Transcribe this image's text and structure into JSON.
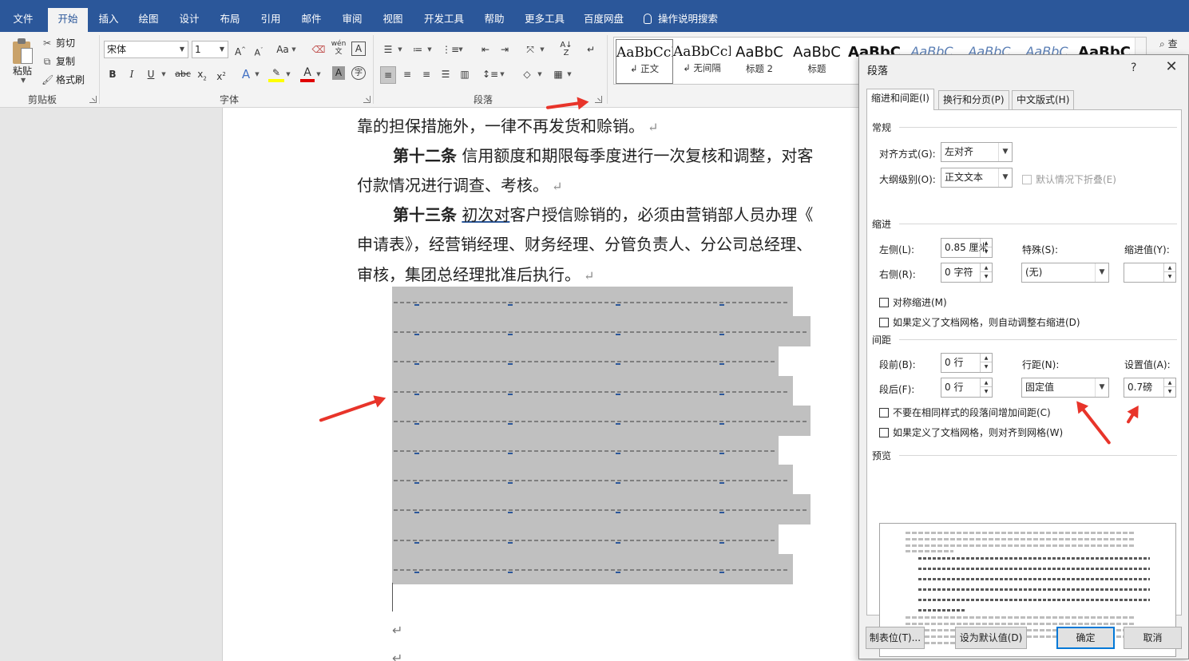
{
  "ribbon": {
    "tabs": [
      "文件",
      "开始",
      "插入",
      "绘图",
      "设计",
      "布局",
      "引用",
      "邮件",
      "审阅",
      "视图",
      "开发工具",
      "帮助",
      "更多工具",
      "百度网盘"
    ],
    "active_tab": "开始",
    "tell_me": "操作说明搜索",
    "clipboard": {
      "paste": "粘贴",
      "cut": "剪切",
      "copy": "复制",
      "format_painter": "格式刷",
      "group_label": "剪贴板"
    },
    "font": {
      "name": "宋体",
      "size": "1",
      "group_label": "字体",
      "change_case": "Aa"
    },
    "paragraph": {
      "group_label": "段落"
    },
    "styles": [
      {
        "sample": "AaBbCcI",
        "name": "↲ 正文"
      },
      {
        "sample": "AaBbCcI",
        "name": "↲ 无间隔"
      },
      {
        "sample": "AaBbC",
        "name": "标题 2"
      },
      {
        "sample": "AaBbC",
        "name": "标题"
      },
      {
        "sample": "AaBbC",
        "name": ""
      },
      {
        "sample": "AaBbC",
        "name": ""
      },
      {
        "sample": "AaBbC",
        "name": ""
      },
      {
        "sample": "AaBbC",
        "name": ""
      },
      {
        "sample": "AaBbC",
        "name": ""
      }
    ],
    "find_label": "查"
  },
  "document": {
    "lines": [
      {
        "text": "靠的担保措施外，一律不再发货和赊销。"
      },
      {
        "bold": "第十二条",
        "text": " 信用额度和期限每季度进行一次复核和调整，对客"
      },
      {
        "text": "付款情况进行调查、考核。"
      },
      {
        "bold": "第十三条",
        "pre": " ",
        "underlined": "初次对",
        "text": "客户授信赊销的，必须由营销部人员办理《"
      },
      {
        "text": "申请表》，经营销经理、财务经理、分管负责人、分公司总经理、"
      },
      {
        "text": "审核，集团总经理批准后执行。"
      }
    ],
    "para_mark": "↵"
  },
  "dialog": {
    "title": "段落",
    "help": "?",
    "close": "✕",
    "tabs": [
      "缩进和间距(I)",
      "换行和分页(P)",
      "中文版式(H)"
    ],
    "general": {
      "section": "常规",
      "alignment_label": "对齐方式(G):",
      "alignment_value": "左对齐",
      "outline_label": "大纲级别(O):",
      "outline_value": "正文文本",
      "collapsed_label": "默认情况下折叠(E)"
    },
    "indent": {
      "section": "缩进",
      "left_label": "左侧(L):",
      "left_value": "0.85 厘米",
      "right_label": "右侧(R):",
      "right_value": "0 字符",
      "special_label": "特殊(S):",
      "special_value": "(无)",
      "by_label": "缩进值(Y):",
      "by_value": "",
      "mirror_label": "对称缩进(M)",
      "auto_adjust_label": "如果定义了文档网格，则自动调整右缩进(D)"
    },
    "spacing": {
      "section": "间距",
      "before_label": "段前(B):",
      "before_value": "0 行",
      "after_label": "段后(F):",
      "after_value": "0 行",
      "line_label": "行距(N):",
      "line_value": "固定值",
      "at_label": "设置值(A):",
      "at_value": "0.7磅",
      "no_space_label": "不要在相同样式的段落间增加间距(C)",
      "snap_grid_label": "如果定义了文档网格，则对齐到网格(W)"
    },
    "preview": {
      "section": "预览"
    },
    "buttons": {
      "tabs": "制表位(T)...",
      "default": "设为默认值(D)",
      "ok": "确定",
      "cancel": "取消"
    }
  },
  "colors": {
    "accent": "#2b579a",
    "arrow": "#e8342a",
    "highlight_block": "#c0c0c0"
  }
}
